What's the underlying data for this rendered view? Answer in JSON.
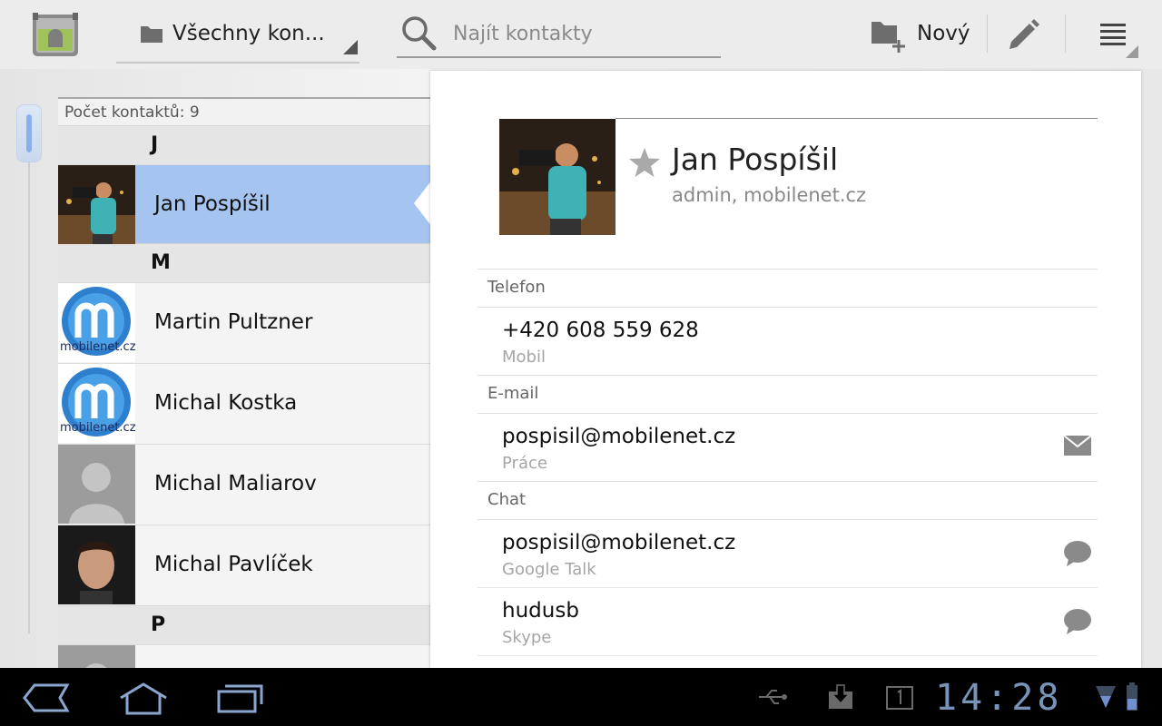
{
  "actionbar": {
    "account_filter": "Všechny kon...",
    "search_placeholder": "Najít kontakty",
    "new_label": "Nový"
  },
  "list": {
    "count": "Počet kontaktů: 9",
    "sections": [
      {
        "letter": "J",
        "contacts": [
          {
            "name": "Jan Pospíšil",
            "selected": true
          }
        ]
      },
      {
        "letter": "M",
        "contacts": [
          {
            "name": "Martin Pultzner"
          },
          {
            "name": "Michal Kostka"
          },
          {
            "name": "Michal Maliarov"
          },
          {
            "name": "Michal Pavlíček"
          }
        ]
      },
      {
        "letter": "P",
        "contacts": []
      }
    ],
    "logo_text": "mobilenet.cz"
  },
  "detail": {
    "name": "Jan Pospíšil",
    "organization": "admin, mobilenet.cz",
    "phone_header": "Telefon",
    "phone": {
      "value": "+420 608 559 628",
      "type": "Mobil"
    },
    "email_header": "E-mail",
    "email": {
      "value": "pospisil@mobilenet.cz",
      "type": "Práce"
    },
    "chat_header": "Chat",
    "chats": [
      {
        "value": "pospisil@mobilenet.cz",
        "type": "Google Talk"
      },
      {
        "value": "hudusb",
        "type": "Skype"
      }
    ]
  },
  "system": {
    "clock": "14:28"
  },
  "colors": {
    "selected_row": "#a6c4f0",
    "clock": "#7893b8"
  }
}
